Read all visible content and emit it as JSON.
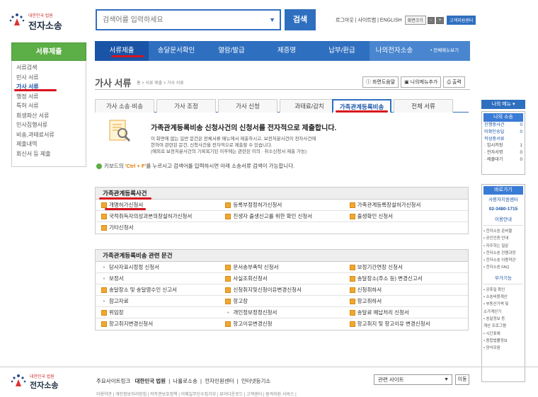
{
  "header": {
    "logo_small": "대한민국 법원",
    "logo_big": "전자소송",
    "search_placeholder": "검색어를 입력하세요",
    "search_button": "검색",
    "util_links": "로그아웃 | 사이트맵 | ENGLISH",
    "util_font_label": "화면크기",
    "util_font_minus": "-",
    "util_font_plus": "+",
    "util_cyber": "고객지원센터"
  },
  "gnb": [
    {
      "label": "서류제출",
      "active": true
    },
    {
      "label": "송달문서확인"
    },
    {
      "label": "열람/발급"
    },
    {
      "label": "제증명"
    },
    {
      "label": "납부/환급"
    },
    {
      "label": "나의전자소송"
    },
    {
      "label": "• 전체메뉴보기"
    }
  ],
  "lnb": {
    "title": "서류제출",
    "items": [
      "서류검색",
      "민사 서류",
      "가사 서류",
      "행정 서류",
      "특허 서류",
      "회생파산 서류",
      "민사집행서류",
      "비송,과태료서류",
      "제출내역",
      "회신서 등 제출"
    ],
    "active_index": 2
  },
  "page": {
    "title": "가사 서류",
    "breadcrumb": "홈 > 서류 제출 > 가사 서류",
    "tools": [
      "화면도움말",
      "나의메뉴추가",
      "출력"
    ]
  },
  "tabs": [
    "가사 소송·비송",
    "가사 조정",
    "가사 신청",
    "과태료/감치",
    "가족관계등록비송",
    "전체 서류"
  ],
  "tabs_active": 4,
  "intro": {
    "heading": "가족관계등록비송 신청사건의 신청서를 전자적으로 제출합니다.",
    "lines": [
      "이 화면에 없는 일반 문건은 전체서류 메뉴에서 제출하시고, 보전처분사건이 전자사건에",
      "한하여 관련된 문건, 신청사건을 전자적으로 제출할 수 있습니다.",
      "(예외로 보전처분사건의 기록복기된 이후에는 관련된 이의 · 취소신청서 제출 가능)"
    ],
    "keyboard_pre": "키보드의 ",
    "keyboard_key": "'Ctrl + F'",
    "keyboard_post": "를 누르시고 검색어를 입력하시면 아래 소송서류 검색이 가능합니다."
  },
  "section1": {
    "title": "가족관계등록사건",
    "rows": [
      [
        {
          "t": "개명허가신청서",
          "i": true
        },
        {
          "t": "등록부정정허가신청서",
          "i": true
        },
        {
          "t": "가족관계등록창설허가신청서",
          "i": true
        }
      ],
      [
        {
          "t": "국적취득자의성과본의창설허가신청서",
          "i": true
        },
        {
          "t": "친생자 출생신고를 위한 확인 신청서",
          "i": true
        },
        {
          "t": "출생확인 신청서",
          "i": true
        }
      ],
      [
        {
          "t": "기타신청서",
          "i": true
        },
        {
          "t": "",
          "i": false
        },
        {
          "t": "",
          "i": false
        }
      ]
    ]
  },
  "section2": {
    "title": "가족관계등록비송 관련 문건",
    "rows": [
      [
        {
          "t": "당사자표시정정 신청서",
          "i": false
        },
        {
          "t": "문서송부촉탁 신청서",
          "i": true
        },
        {
          "t": "보정기간연장 신청서",
          "i": true
        }
      ],
      [
        {
          "t": "보정서",
          "i": false
        },
        {
          "t": "사실조회신청서",
          "i": true
        },
        {
          "t": "송달장소(주소 등) 변경신고서",
          "i": true
        }
      ],
      [
        {
          "t": "송달장소 및 송달영수인 신고서",
          "i": true
        },
        {
          "t": "신청취지및신청이유변경신청서",
          "i": true
        },
        {
          "t": "신청취하서",
          "i": true
        }
      ],
      [
        {
          "t": "참고자료",
          "i": false
        },
        {
          "t": "항고장",
          "i": true
        },
        {
          "t": "항고취하서",
          "i": true
        }
      ],
      [
        {
          "t": "위임장",
          "i": true
        },
        {
          "t": "개인정보정정신청서",
          "i": false
        },
        {
          "t": "송달료 예납처리 신청서",
          "i": true
        }
      ],
      [
        {
          "t": "항고취지변경신청서",
          "i": true
        },
        {
          "t": "항고이유변경신청",
          "i": true
        },
        {
          "t": "항고취지 및 항고이유 변경신청서",
          "i": true
        }
      ]
    ]
  },
  "right_panel": {
    "menu_label": "나의 메뉴 ▾",
    "status_title": "나의 소송",
    "status": [
      {
        "label": "진행중사건",
        "value": "0"
      },
      {
        "label": "미확인송달",
        "value": "0"
      },
      {
        "label": "작성중서류",
        "value": ""
      },
      {
        "label": "· 임시저장",
        "value": "1"
      },
      {
        "label": "· 전자서명",
        "value": "0"
      },
      {
        "label": "· 제출대기",
        "value": "0"
      }
    ],
    "shortcut_title": "바로가기",
    "tel_label": "사용자지원센터",
    "tel": "02-3480-1715",
    "guide": "이용안내",
    "links1": [
      "• 전자소송 준비물",
      "• 공인인증 안내",
      "• 자주하는 질문",
      "• 전자소송 진행과정",
      "• 전자소송 이용약관",
      "• 전자소송 FAQ"
    ],
    "tools_title": "부가기능",
    "links2": [
      "• 공휴일 확인",
      "• 소송비용계산",
      "• 부동산가액 및",
      "  소가계산기",
      "• 송달정보 등",
      "  계산 프로그램",
      "• 시간표예",
      "• 종합법률정보",
      "• 양식모음"
    ]
  },
  "footer": {
    "logo_small": "대한민국 법원",
    "logo_big": "전자소송",
    "related_prefix": "주요사이트링크",
    "related_links": [
      "대한민국 법원",
      "나홀로소송",
      "전자민원센터",
      "인터넷등기소"
    ],
    "select_label": "관련 사이트",
    "move_label": "이동",
    "bottom_text": "이용약관 | 개인정보처리방침 | 저작권보호정책 | 이메일무단수집거부 | 뷰어다운로드 | 고객센터 | 원격지원 서비스 |"
  }
}
